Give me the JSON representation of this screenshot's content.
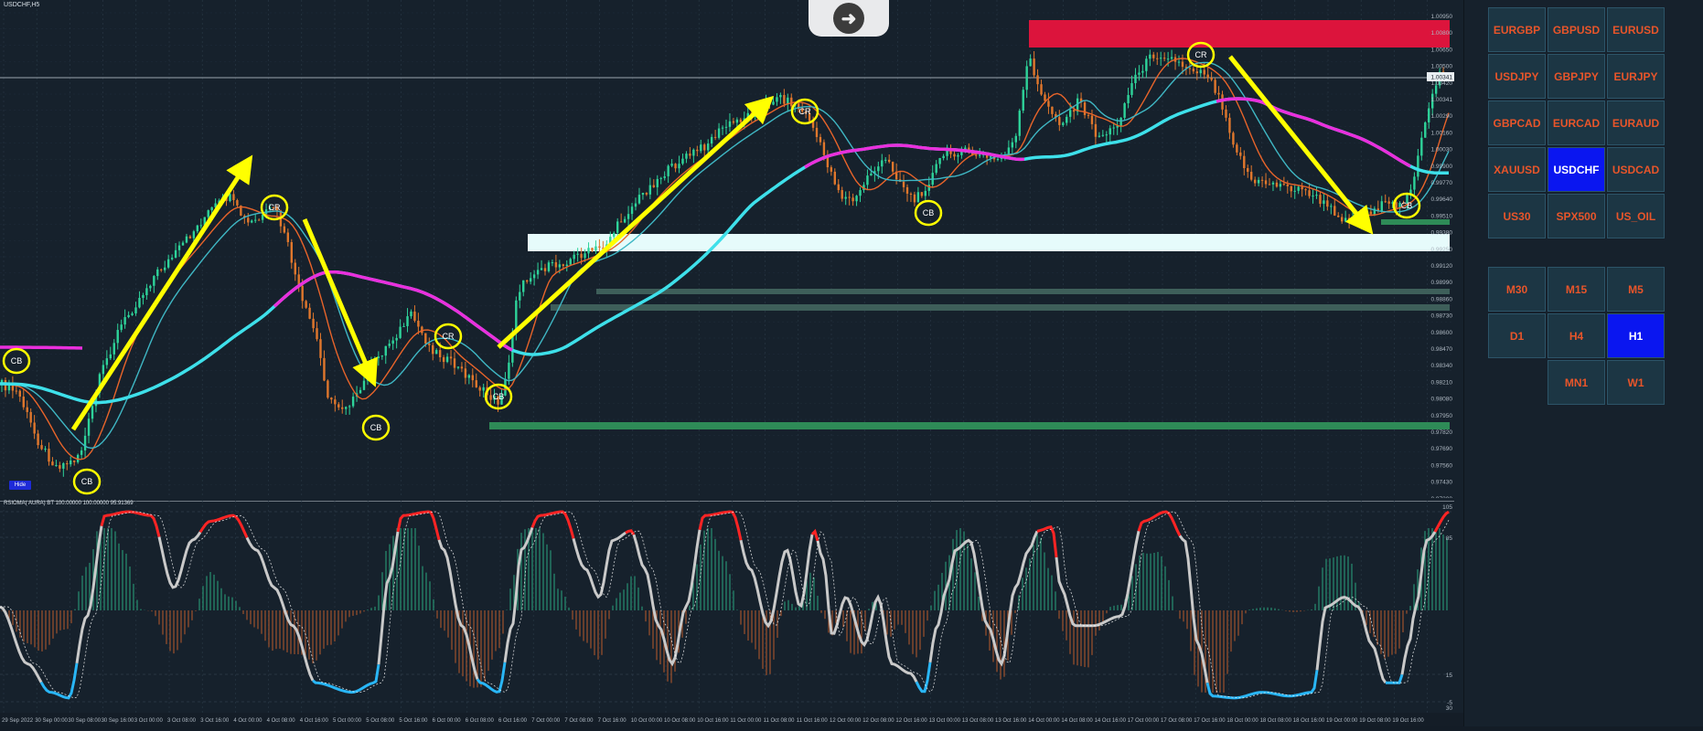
{
  "chart": {
    "symbol_title": "USDCHF,H5",
    "indicator_title": "RSIOMA( AURA) BT 100.00000 100.00000 95.91369",
    "hide_label": "Hide",
    "price_axis": [
      "1.00950",
      "1.00800",
      "1.00650",
      "1.00500",
      "1.00420",
      "1.00341",
      "1.00290",
      "1.00160",
      "1.00030",
      "0.99900",
      "0.99770",
      "0.99640",
      "0.99510",
      "0.99380",
      "0.99250",
      "0.99120",
      "0.98990",
      "0.98860",
      "0.98730",
      "0.98600",
      "0.98470",
      "0.98340",
      "0.98210",
      "0.98080",
      "0.97950",
      "0.97820",
      "0.97690",
      "0.97560",
      "0.97430",
      "0.97300"
    ],
    "current_price": "1.00341",
    "osc_axis": [
      "105",
      "85",
      "15",
      "-5",
      "30"
    ],
    "time_axis": [
      "29 Sep 2022",
      "30 Sep 00:00",
      "30 Sep 08:00",
      "30 Sep 16:00",
      "3 Oct 00:00",
      "3 Oct 08:00",
      "3 Oct 16:00",
      "4 Oct 00:00",
      "4 Oct 08:00",
      "4 Oct 16:00",
      "5 Oct 00:00",
      "5 Oct 08:00",
      "5 Oct 16:00",
      "6 Oct 00:00",
      "6 Oct 08:00",
      "6 Oct 16:00",
      "7 Oct 00:00",
      "7 Oct 08:00",
      "7 Oct 16:00",
      "10 Oct 00:00",
      "10 Oct 08:00",
      "10 Oct 16:00",
      "11 Oct 00:00",
      "11 Oct 08:00",
      "11 Oct 16:00",
      "12 Oct 00:00",
      "12 Oct 08:00",
      "12 Oct 16:00",
      "13 Oct 00:00",
      "13 Oct 08:00",
      "13 Oct 16:00",
      "14 Oct 00:00",
      "14 Oct 08:00",
      "14 Oct 16:00",
      "17 Oct 00:00",
      "17 Oct 08:00",
      "17 Oct 16:00",
      "18 Oct 00:00",
      "18 Oct 08:00",
      "18 Oct 16:00",
      "19 Oct 00:00",
      "19 Oct 08:00",
      "19 Oct 16:00"
    ],
    "signal_markers": [
      "CR",
      "CB"
    ],
    "colors": {
      "bull_candle": "#2ed39a",
      "bear_candle": "#e0772c",
      "ma_fast": "#e8642a",
      "ma_mid": "#3fb7c4",
      "ma_slow_pink": "#ea2fdc",
      "ma_slow_cyan": "#3ee0ea",
      "arrow": "#ffff00",
      "resistance_zone": "#dc143c",
      "support_zone": "#e6fbfb",
      "support_line": "#2e8b57",
      "osc_line": "#c9c9c9",
      "osc_overbought": "#ff2424",
      "osc_oversold": "#29b6f6"
    }
  },
  "overlay_button": {
    "icon": "remote-control-icon"
  },
  "symbols": {
    "rows": [
      [
        "EURGBP",
        "GBPUSD",
        "EURUSD"
      ],
      [
        "USDJPY",
        "GBPJPY",
        "EURJPY"
      ],
      [
        "GBPCAD",
        "EURCAD",
        "EURAUD"
      ],
      [
        "XAUUSD",
        "USDCHF",
        "USDCAD"
      ],
      [
        "US30",
        "SPX500",
        "US_OIL"
      ]
    ],
    "active": "USDCHF"
  },
  "timeframes": {
    "rows": [
      [
        "M30",
        "M15",
        "M5"
      ],
      [
        "D1",
        "H4",
        "H1"
      ],
      [
        "",
        "MN1",
        "W1"
      ]
    ],
    "active": "H1"
  }
}
